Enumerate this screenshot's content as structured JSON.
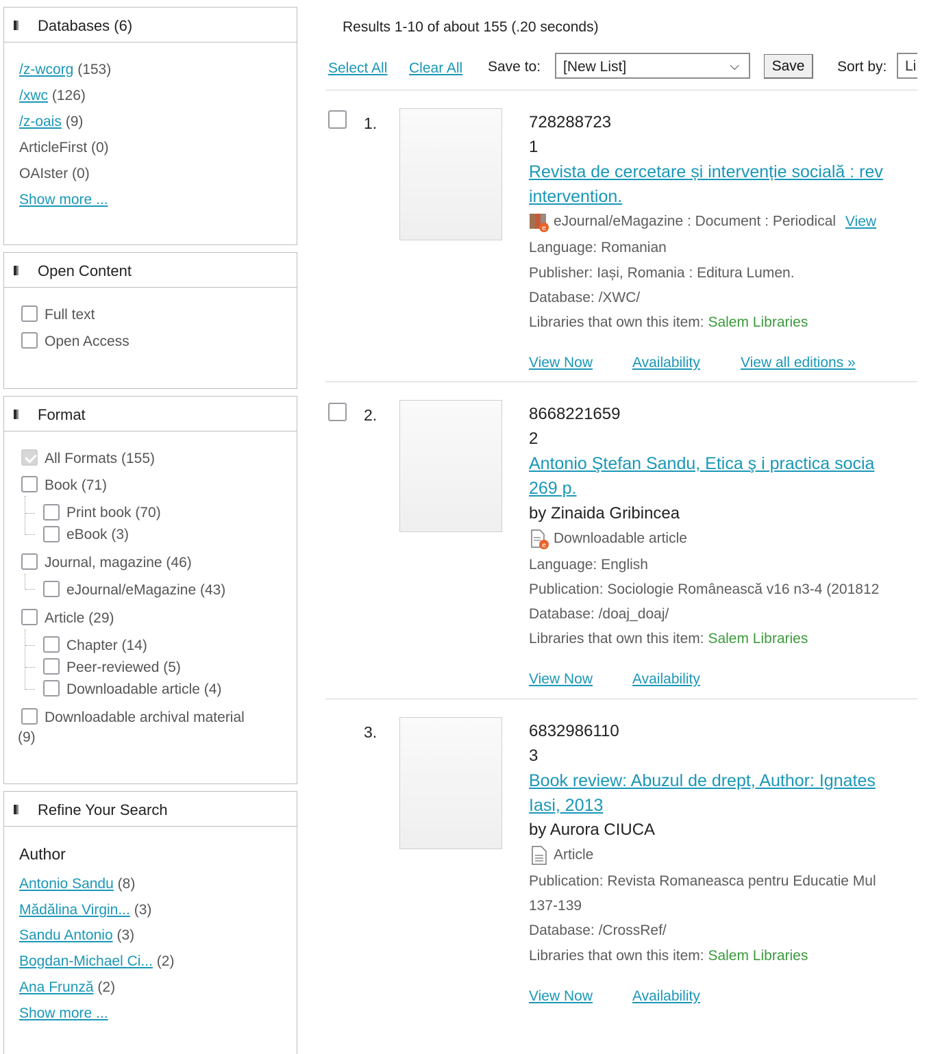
{
  "sidebar": {
    "databases": {
      "title": "Databases (6)",
      "items": [
        {
          "label": "/z-wcorg",
          "count": "(153)",
          "link": true
        },
        {
          "label": "/xwc",
          "count": "(126)",
          "link": true
        },
        {
          "label": "/z-oais",
          "count": "(9)",
          "link": true
        },
        {
          "label": "ArticleFirst (0)",
          "count": "",
          "link": false
        },
        {
          "label": "OAIster (0)",
          "count": "",
          "link": false
        }
      ],
      "show_more": "Show more ..."
    },
    "open_content": {
      "title": "Open Content",
      "items": [
        "Full text",
        "Open Access"
      ]
    },
    "format": {
      "title": "Format",
      "all": "All Formats  (155)",
      "book": "Book (71)",
      "print_book": "Print book (70)",
      "ebook": "eBook (3)",
      "journal": "Journal, magazine (46)",
      "ejournal": "eJournal/eMagazine (43)",
      "article": "Article (29)",
      "chapter": "Chapter (14)",
      "peer": "Peer-reviewed (5)",
      "download_article": "Downloadable article (4)",
      "archival": "Downloadable archival material",
      "archival_count": "(9)"
    },
    "refine": {
      "title": "Refine Your Search",
      "author_heading": "Author",
      "authors": [
        {
          "label": "Antonio Sandu",
          "count": "(8)"
        },
        {
          "label": "Mădălina Virgin...",
          "count": "(3)"
        },
        {
          "label": "Sandu Antonio",
          "count": "(3)"
        },
        {
          "label": "Bogdan-Michael Ci...",
          "count": "(2)"
        },
        {
          "label": "Ana Frunză",
          "count": "(2)"
        }
      ],
      "show_more": "Show more ..."
    }
  },
  "results_header": {
    "summary": "Results 1-10 of about 155 (.20 seconds)",
    "select_all": "Select All",
    "clear_all": "Clear All",
    "save_to_label": "Save to:",
    "save_to_value": "[New List]",
    "save_button": "Save",
    "sort_label": "Sort by:",
    "sort_value": "Li"
  },
  "results": [
    {
      "num": "1.",
      "id": "728288723",
      "index": "1",
      "title_line1": "Revista de cercetare și intervenție socială : rev",
      "title_line2": "intervention.",
      "format": "eJournal/eMagazine : Document : Periodical",
      "format_link": "View",
      "language": "Language: Romanian",
      "publisher": "Publisher: Iași, Romania : Editura Lumen.",
      "database": "Database: /XWC/",
      "owners_label": "Libraries that own this item:",
      "owners": "Salem Libraries",
      "view_now": "View Now",
      "availability": "Availability",
      "editions": "View all editions »"
    },
    {
      "num": "2.",
      "id": "8668221659",
      "index": "2",
      "title_line1": "Antonio Ştefan Sandu, Etica ş i practica socia",
      "title_line2": "269 p.",
      "author": "by Zinaida Gribincea",
      "format": "Downloadable article",
      "language": "Language: English",
      "publication": "Publication: Sociologie Românească v16 n3-4 (201812",
      "database": "Database: /doaj_doaj/",
      "owners_label": "Libraries that own this item:",
      "owners": "Salem Libraries",
      "view_now": "View Now",
      "availability": "Availability"
    },
    {
      "num": "3.",
      "id": "6832986110",
      "index": "3",
      "title_line1": "Book review: Abuzul de drept, Author: Ignates",
      "title_line2": "Iasi, 2013",
      "author": "by Aurora CIUCA",
      "format": "Article",
      "publication": "Publication: Revista Romaneasca pentru Educatie Mul",
      "pages": "137-139",
      "database": "Database: /CrossRef/",
      "owners_label": "Libraries that own this item:",
      "owners": "Salem Libraries",
      "view_now": "View Now",
      "availability": "Availability"
    }
  ],
  "colors": {
    "link": "#1a97b8",
    "owners": "#3c9a3c",
    "border": "#bdbdbd"
  }
}
